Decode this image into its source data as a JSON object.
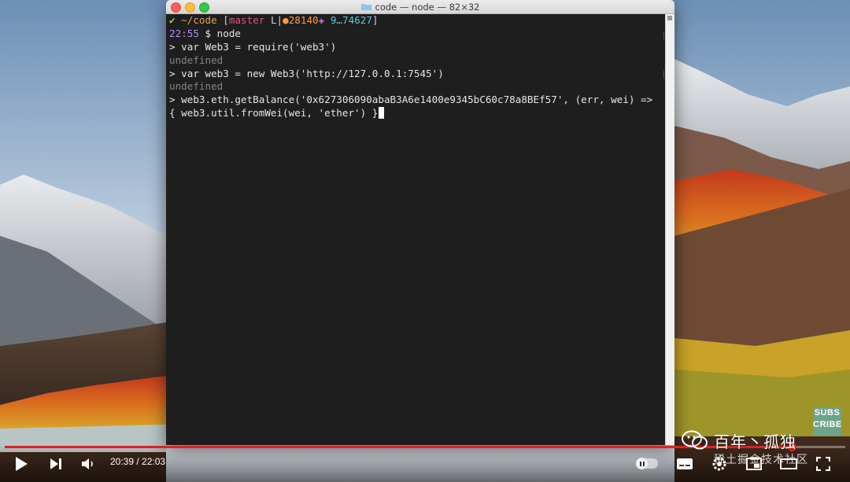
{
  "window": {
    "title": "code — node — 82×32"
  },
  "terminal": {
    "prompt_check": "✔",
    "prompt_dir": "~/code",
    "prompt_bracket_open": "[",
    "prompt_branch": "master",
    "prompt_sep": "L|",
    "prompt_ahead": "●28140",
    "prompt_plus": "✚",
    "prompt_behind": "9…74627",
    "prompt_bracket_close": "]",
    "prompt_time": "22:55",
    "prompt_command": "$ node",
    "lines": [
      "> var Web3 = require('web3')",
      "undefined",
      "> var web3 = new Web3('http://127.0.0.1:7545')",
      "undefined",
      "> web3.eth.getBalance('0x627306090abaB3A6e1400e9345bC60c78a8BEf57', (err, wei) =>",
      "{ web3.util.fromWei(wei, 'ether') }"
    ]
  },
  "player": {
    "time": "20:39 / 22:03",
    "progress": 0.936
  },
  "overlay": {
    "subscribe": "SUBSCRIBE",
    "subscribe_line1": "SUBS",
    "subscribe_line2": "CRIBE",
    "watermark_name": "百年丶孤独",
    "watermark_sub": "稀土掘金技术社区"
  },
  "colors": {
    "check": "#9bd24b",
    "dir": "#e4a44a",
    "bracket": "#d0d0d0",
    "branch": "#e44f7a",
    "ahead": "#ff9a3c",
    "plus": "#c678dd",
    "behind": "#61c5e6",
    "time": "#b98cf2",
    "progress": "#e32020"
  }
}
